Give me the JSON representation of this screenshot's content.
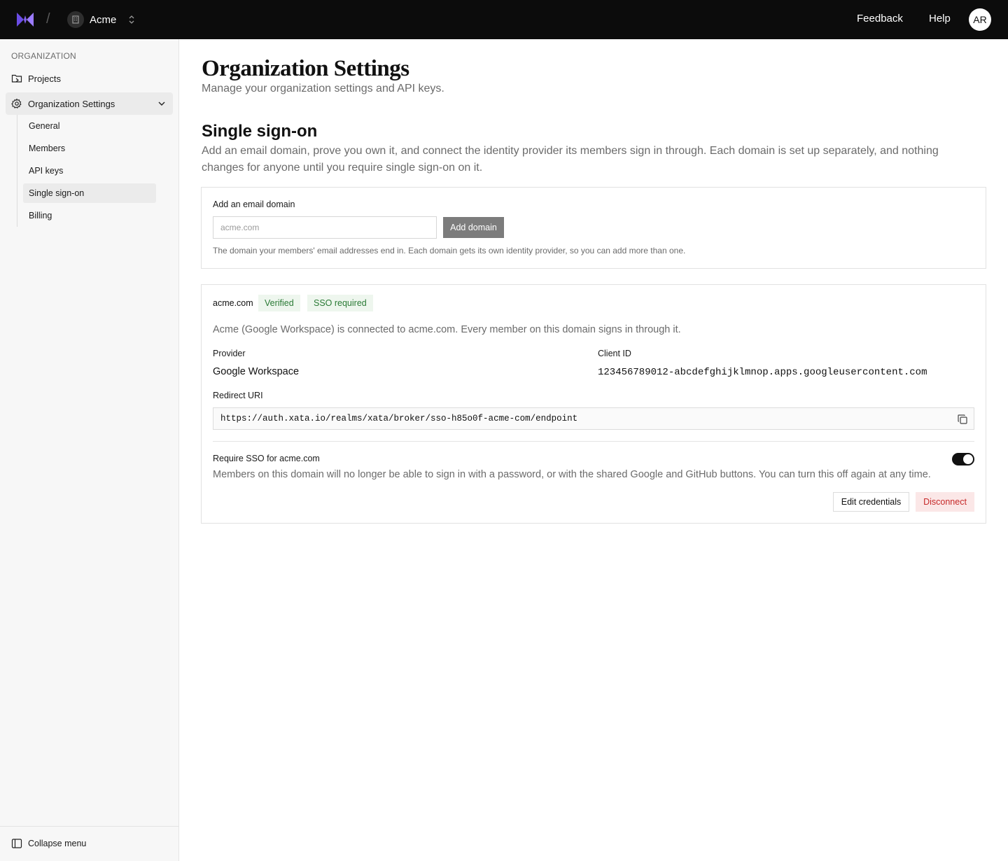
{
  "topbar": {
    "org_name": "Acme",
    "feedback_label": "Feedback",
    "help_label": "Help",
    "avatar_initials": "AR",
    "logo_icon": "butterfly-logo",
    "brand_color": "#7c5cf5"
  },
  "sidebar": {
    "section_label": "ORGANIZATION",
    "projects_label": "Projects",
    "org_settings_label": "Organization Settings",
    "sub_items": [
      "General",
      "Members",
      "API keys",
      "Single sign-on",
      "Billing"
    ],
    "active_sub_item": "Single sign-on",
    "collapse_label": "Collapse menu"
  },
  "main": {
    "title": "Organization Settings",
    "subtitle": "Manage your organization settings and API keys.",
    "section_title": "Single sign-on",
    "section_description": "Add an email domain, prove you own it, and connect the identity provider its members sign in through. Each domain is set up separately, and nothing changes for anyone until you require single sign-on on it."
  },
  "add_domain": {
    "label": "Add an email domain",
    "placeholder": "acme.com",
    "value": "",
    "button_label": "Add domain",
    "help_text": "The domain your members' email addresses end in. Each domain gets its own identity provider, so you can add more than one."
  },
  "domain_card": {
    "domain": "acme.com",
    "badge_verified": "Verified",
    "badge_sso": "SSO required",
    "status_text": "Acme (Google Workspace) is connected to acme.com. Every member on this domain signs in through it.",
    "provider_label": "Provider",
    "provider_value": "Google Workspace",
    "client_id_label": "Client ID",
    "client_id_value": "123456789012-abcdefghijklmnop.apps.googleusercontent.com",
    "redirect_label": "Redirect URI",
    "redirect_value": "https://auth.xata.io/realms/xata/broker/sso-h85o0f-acme-com/endpoint",
    "require_label": "Require SSO for acme.com",
    "require_description": "Members on this domain will no longer be able to sign in with a password, or with the shared Google and GitHub buttons. You can turn this off again at any time.",
    "require_enabled": true,
    "edit_label": "Edit credentials",
    "disconnect_label": "Disconnect",
    "badge_color": "#2a7a35",
    "danger_color": "#c62828"
  }
}
